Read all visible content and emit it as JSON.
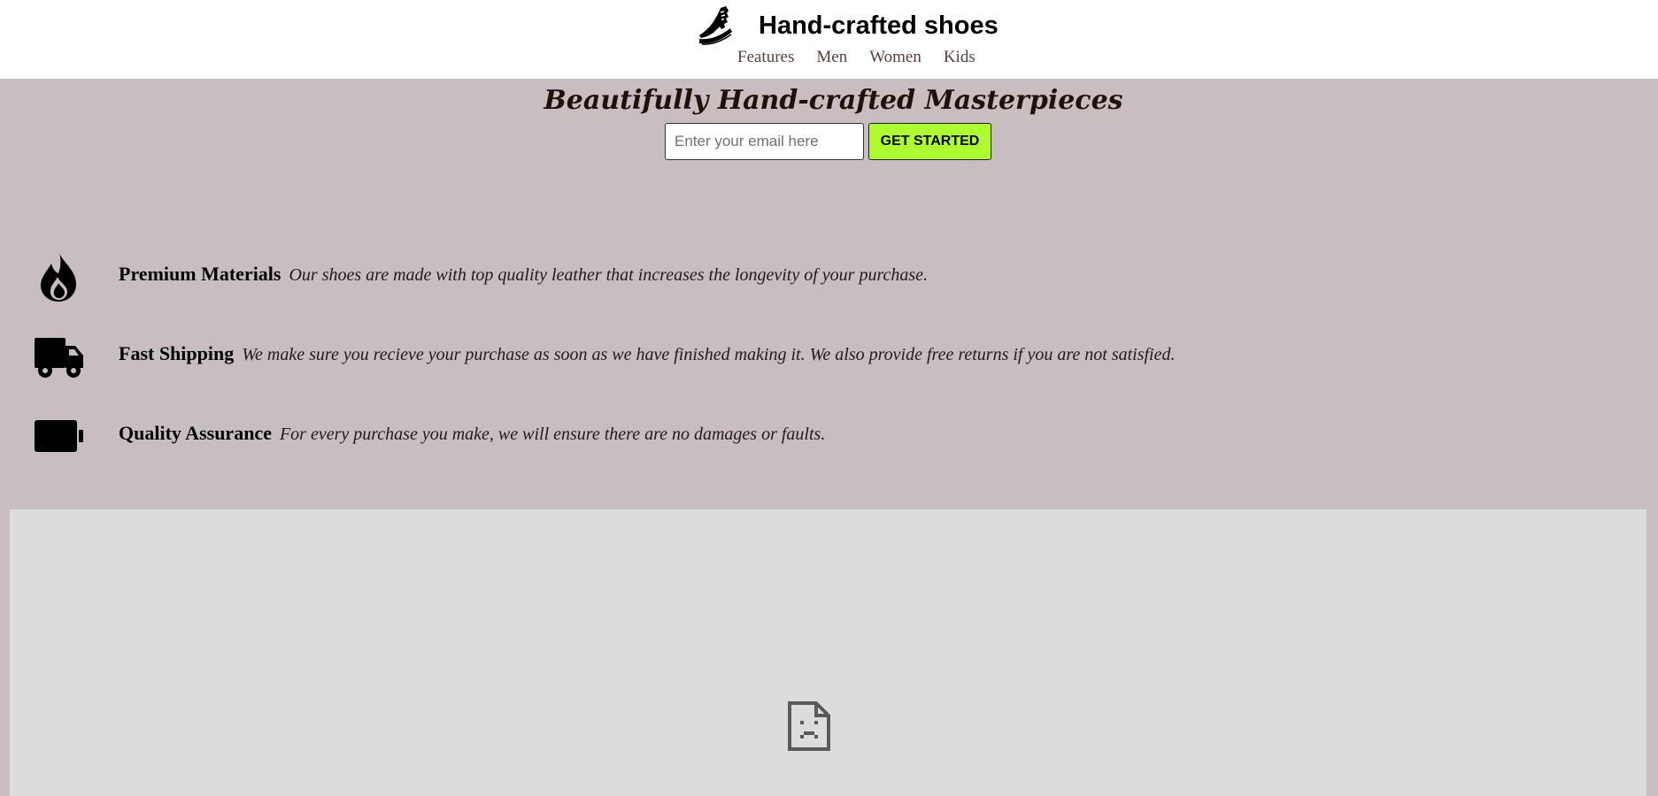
{
  "header": {
    "title": "Hand-crafted shoes",
    "logo_icon": "running-shoe-icon",
    "nav": [
      {
        "label": "Features"
      },
      {
        "label": "Men"
      },
      {
        "label": "Women"
      },
      {
        "label": "Kids"
      }
    ]
  },
  "hero": {
    "title": "Beautifully Hand-crafted Masterpieces",
    "email_placeholder": "Enter your email here",
    "email_value": "",
    "cta_label": "GET STARTED"
  },
  "features": [
    {
      "icon": "fire-icon",
      "name": "Premium Materials",
      "description": "Our shoes are made with top quality leather that increases the longevity of your purchase."
    },
    {
      "icon": "truck-icon",
      "name": "Fast Shipping",
      "description": "We make sure you recieve your purchase as soon as we have finished making it. We also provide free returns if you are not satisfied."
    },
    {
      "icon": "battery-full-icon",
      "name": "Quality Assurance",
      "description": "For every purchase you make, we will ensure there are no damages or faults."
    }
  ],
  "video": {
    "status_icon": "broken-document-icon"
  },
  "colors": {
    "page_background": "#c8bebf",
    "header_background": "#ffffff",
    "nav_link": "#5a3f3f",
    "cta_background": "#adfc2f",
    "video_placeholder": "#dcdcdc"
  }
}
